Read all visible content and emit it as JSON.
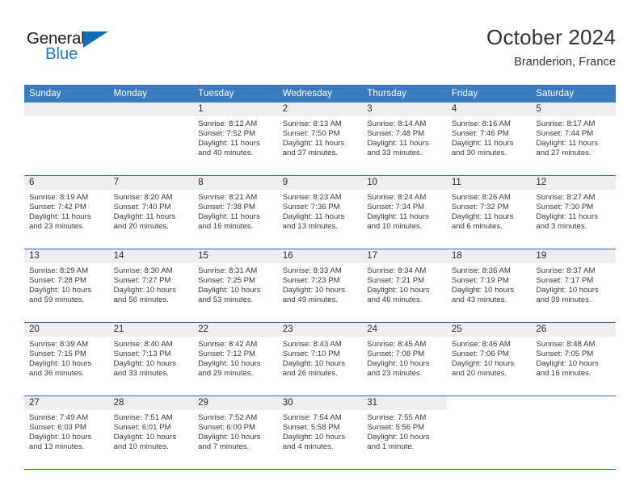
{
  "brand": {
    "name_primary": "General",
    "name_secondary": "Blue",
    "flag_icon": "triangle-flag-icon",
    "accent_color": "#0f6cb5"
  },
  "header": {
    "month_title": "October 2024",
    "location": "Branderion, France"
  },
  "theme": {
    "header_row_bg": "#3a7cbe",
    "grid_line": "#2f6fb0",
    "daynum_band_bg": "#eeeeee",
    "text": "#2b2b2b"
  },
  "weekday_headers": [
    "Sunday",
    "Monday",
    "Tuesday",
    "Wednesday",
    "Thursday",
    "Friday",
    "Saturday"
  ],
  "weeks": [
    [
      {
        "day": "",
        "blank": true,
        "shade": true,
        "sunrise": "",
        "sunset": "",
        "daylight_line1": "",
        "daylight_line2": ""
      },
      {
        "day": "",
        "blank": true,
        "shade": true,
        "sunrise": "",
        "sunset": "",
        "daylight_line1": "",
        "daylight_line2": ""
      },
      {
        "day": "1",
        "sunrise": "Sunrise: 8:12 AM",
        "sunset": "Sunset: 7:52 PM",
        "daylight_line1": "Daylight: 11 hours",
        "daylight_line2": "and 40 minutes."
      },
      {
        "day": "2",
        "sunrise": "Sunrise: 8:13 AM",
        "sunset": "Sunset: 7:50 PM",
        "daylight_line1": "Daylight: 11 hours",
        "daylight_line2": "and 37 minutes."
      },
      {
        "day": "3",
        "sunrise": "Sunrise: 8:14 AM",
        "sunset": "Sunset: 7:48 PM",
        "daylight_line1": "Daylight: 11 hours",
        "daylight_line2": "and 33 minutes."
      },
      {
        "day": "4",
        "sunrise": "Sunrise: 8:16 AM",
        "sunset": "Sunset: 7:46 PM",
        "daylight_line1": "Daylight: 11 hours",
        "daylight_line2": "and 30 minutes."
      },
      {
        "day": "5",
        "sunrise": "Sunrise: 8:17 AM",
        "sunset": "Sunset: 7:44 PM",
        "daylight_line1": "Daylight: 11 hours",
        "daylight_line2": "and 27 minutes."
      }
    ],
    [
      {
        "day": "6",
        "sunrise": "Sunrise: 8:19 AM",
        "sunset": "Sunset: 7:42 PM",
        "daylight_line1": "Daylight: 11 hours",
        "daylight_line2": "and 23 minutes."
      },
      {
        "day": "7",
        "sunrise": "Sunrise: 8:20 AM",
        "sunset": "Sunset: 7:40 PM",
        "daylight_line1": "Daylight: 11 hours",
        "daylight_line2": "and 20 minutes."
      },
      {
        "day": "8",
        "sunrise": "Sunrise: 8:21 AM",
        "sunset": "Sunset: 7:38 PM",
        "daylight_line1": "Daylight: 11 hours",
        "daylight_line2": "and 16 minutes."
      },
      {
        "day": "9",
        "sunrise": "Sunrise: 8:23 AM",
        "sunset": "Sunset: 7:36 PM",
        "daylight_line1": "Daylight: 11 hours",
        "daylight_line2": "and 13 minutes."
      },
      {
        "day": "10",
        "sunrise": "Sunrise: 8:24 AM",
        "sunset": "Sunset: 7:34 PM",
        "daylight_line1": "Daylight: 11 hours",
        "daylight_line2": "and 10 minutes."
      },
      {
        "day": "11",
        "sunrise": "Sunrise: 8:26 AM",
        "sunset": "Sunset: 7:32 PM",
        "daylight_line1": "Daylight: 11 hours",
        "daylight_line2": "and 6 minutes."
      },
      {
        "day": "12",
        "sunrise": "Sunrise: 8:27 AM",
        "sunset": "Sunset: 7:30 PM",
        "daylight_line1": "Daylight: 11 hours",
        "daylight_line2": "and 3 minutes."
      }
    ],
    [
      {
        "day": "13",
        "sunrise": "Sunrise: 8:29 AM",
        "sunset": "Sunset: 7:28 PM",
        "daylight_line1": "Daylight: 10 hours",
        "daylight_line2": "and 59 minutes."
      },
      {
        "day": "14",
        "sunrise": "Sunrise: 8:30 AM",
        "sunset": "Sunset: 7:27 PM",
        "daylight_line1": "Daylight: 10 hours",
        "daylight_line2": "and 56 minutes."
      },
      {
        "day": "15",
        "sunrise": "Sunrise: 8:31 AM",
        "sunset": "Sunset: 7:25 PM",
        "daylight_line1": "Daylight: 10 hours",
        "daylight_line2": "and 53 minutes."
      },
      {
        "day": "16",
        "sunrise": "Sunrise: 8:33 AM",
        "sunset": "Sunset: 7:23 PM",
        "daylight_line1": "Daylight: 10 hours",
        "daylight_line2": "and 49 minutes."
      },
      {
        "day": "17",
        "sunrise": "Sunrise: 8:34 AM",
        "sunset": "Sunset: 7:21 PM",
        "daylight_line1": "Daylight: 10 hours",
        "daylight_line2": "and 46 minutes."
      },
      {
        "day": "18",
        "sunrise": "Sunrise: 8:36 AM",
        "sunset": "Sunset: 7:19 PM",
        "daylight_line1": "Daylight: 10 hours",
        "daylight_line2": "and 43 minutes."
      },
      {
        "day": "19",
        "sunrise": "Sunrise: 8:37 AM",
        "sunset": "Sunset: 7:17 PM",
        "daylight_line1": "Daylight: 10 hours",
        "daylight_line2": "and 39 minutes."
      }
    ],
    [
      {
        "day": "20",
        "sunrise": "Sunrise: 8:39 AM",
        "sunset": "Sunset: 7:15 PM",
        "daylight_line1": "Daylight: 10 hours",
        "daylight_line2": "and 36 minutes."
      },
      {
        "day": "21",
        "sunrise": "Sunrise: 8:40 AM",
        "sunset": "Sunset: 7:13 PM",
        "daylight_line1": "Daylight: 10 hours",
        "daylight_line2": "and 33 minutes."
      },
      {
        "day": "22",
        "sunrise": "Sunrise: 8:42 AM",
        "sunset": "Sunset: 7:12 PM",
        "daylight_line1": "Daylight: 10 hours",
        "daylight_line2": "and 29 minutes."
      },
      {
        "day": "23",
        "sunrise": "Sunrise: 8:43 AM",
        "sunset": "Sunset: 7:10 PM",
        "daylight_line1": "Daylight: 10 hours",
        "daylight_line2": "and 26 minutes."
      },
      {
        "day": "24",
        "sunrise": "Sunrise: 8:45 AM",
        "sunset": "Sunset: 7:08 PM",
        "daylight_line1": "Daylight: 10 hours",
        "daylight_line2": "and 23 minutes."
      },
      {
        "day": "25",
        "sunrise": "Sunrise: 8:46 AM",
        "sunset": "Sunset: 7:06 PM",
        "daylight_line1": "Daylight: 10 hours",
        "daylight_line2": "and 20 minutes."
      },
      {
        "day": "26",
        "sunrise": "Sunrise: 8:48 AM",
        "sunset": "Sunset: 7:05 PM",
        "daylight_line1": "Daylight: 10 hours",
        "daylight_line2": "and 16 minutes."
      }
    ],
    [
      {
        "day": "27",
        "sunrise": "Sunrise: 7:49 AM",
        "sunset": "Sunset: 6:03 PM",
        "daylight_line1": "Daylight: 10 hours",
        "daylight_line2": "and 13 minutes."
      },
      {
        "day": "28",
        "sunrise": "Sunrise: 7:51 AM",
        "sunset": "Sunset: 6:01 PM",
        "daylight_line1": "Daylight: 10 hours",
        "daylight_line2": "and 10 minutes."
      },
      {
        "day": "29",
        "sunrise": "Sunrise: 7:52 AM",
        "sunset": "Sunset: 6:00 PM",
        "daylight_line1": "Daylight: 10 hours",
        "daylight_line2": "and 7 minutes."
      },
      {
        "day": "30",
        "sunrise": "Sunrise: 7:54 AM",
        "sunset": "Sunset: 5:58 PM",
        "daylight_line1": "Daylight: 10 hours",
        "daylight_line2": "and 4 minutes."
      },
      {
        "day": "31",
        "sunrise": "Sunrise: 7:55 AM",
        "sunset": "Sunset: 5:56 PM",
        "daylight_line1": "Daylight: 10 hours",
        "daylight_line2": "and 1 minute."
      },
      {
        "day": "",
        "blank": true,
        "shade": false,
        "sunrise": "",
        "sunset": "",
        "daylight_line1": "",
        "daylight_line2": ""
      },
      {
        "day": "",
        "blank": true,
        "shade": false,
        "sunrise": "",
        "sunset": "",
        "daylight_line1": "",
        "daylight_line2": ""
      }
    ]
  ]
}
